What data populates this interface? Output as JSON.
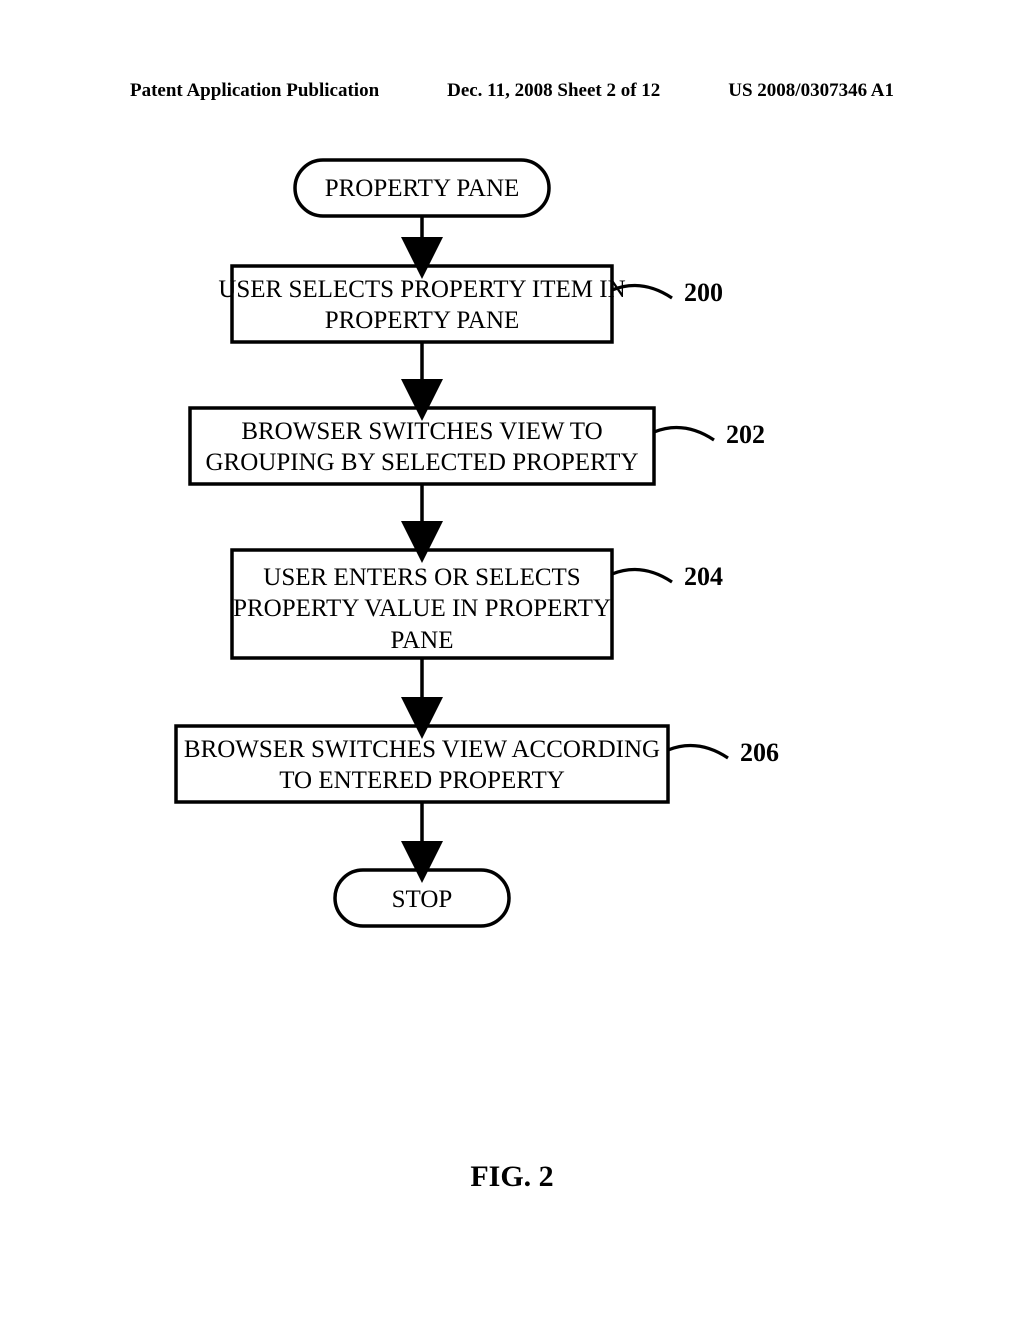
{
  "header": {
    "pub_type": "Patent Application Publication",
    "date_sheet": "Dec. 11, 2008  Sheet 2 of 12",
    "pub_number": "US 2008/0307346 A1"
  },
  "nodes": {
    "start": "PROPERTY PANE",
    "step200": "USER SELECTS PROPERTY ITEM IN PROPERTY PANE",
    "step202": "BROWSER SWITCHES VIEW TO GROUPING BY SELECTED PROPERTY",
    "step204": "USER ENTERS OR SELECTS PROPERTY VALUE IN PROPERTY PANE",
    "step206": "BROWSER SWITCHES VIEW ACCORDING TO ENTERED PROPERTY",
    "stop": "STOP"
  },
  "refs": {
    "r200": "200",
    "r202": "202",
    "r204": "204",
    "r206": "206"
  },
  "figure": "FIG. 2"
}
